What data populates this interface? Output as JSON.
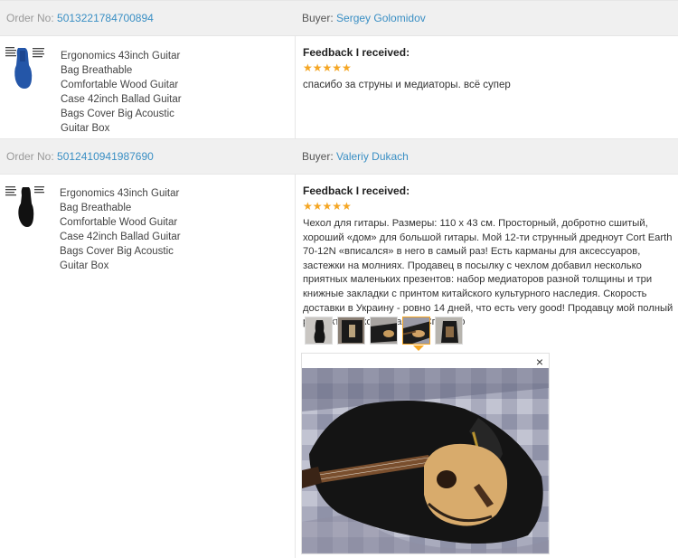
{
  "orders": [
    {
      "order_label": "Order No:",
      "order_number": "5013221784700894",
      "buyer_label": "Buyer:",
      "buyer_name": "Sergey Golomidov",
      "product_name": "Ergonomics 43inch Guitar Bag Breathable Comfortable Wood Guitar Case 42inch Ballad Guitar Bags Cover Big Acoustic Guitar Box",
      "feedback_title": "Feedback I received:",
      "stars": "★★★★★",
      "rating": 5,
      "feedback_text": "спасибо за струны и медиаторы. всё супер"
    },
    {
      "order_label": "Order No:",
      "order_number": "5012410941987690",
      "buyer_label": "Buyer:",
      "buyer_name": "Valeriy Dukach",
      "product_name": "Ergonomics 43inch Guitar Bag Breathable Comfortable Wood Guitar Case 42inch Ballad Guitar Bags Cover Big Acoustic Guitar Box",
      "feedback_title": "Feedback I received:",
      "stars": "★★★★★",
      "rating": 5,
      "feedback_text": "Чехол для гитары. Размеры: 110 x 43 см. Просторный, добротно сшитый, хороший «дом» для большой гитары. Мой 12-ти струнный дредноут Cort Earth 70-12N «вписался» в него в самый раз! Есть карманы для аксессуаров, застежки на молниях. Продавец в посылку с чехлом добавил несколько приятных маленьких презентов: набор медиаторов разной толщины и три книжные закладки с принтом китайского культурного наследия. Скорость доставки в Украину - ровно 14 дней, что есть very good! Продавцу мой полный респект и рекомендации! Спасибо",
      "photo_count": 5,
      "selected_photo": 4
    }
  ],
  "viewer": {
    "close_symbol": "×"
  },
  "colors": {
    "link": "#3a8fc4",
    "star": "#f5a623",
    "header_bg": "#f0f0f0"
  }
}
